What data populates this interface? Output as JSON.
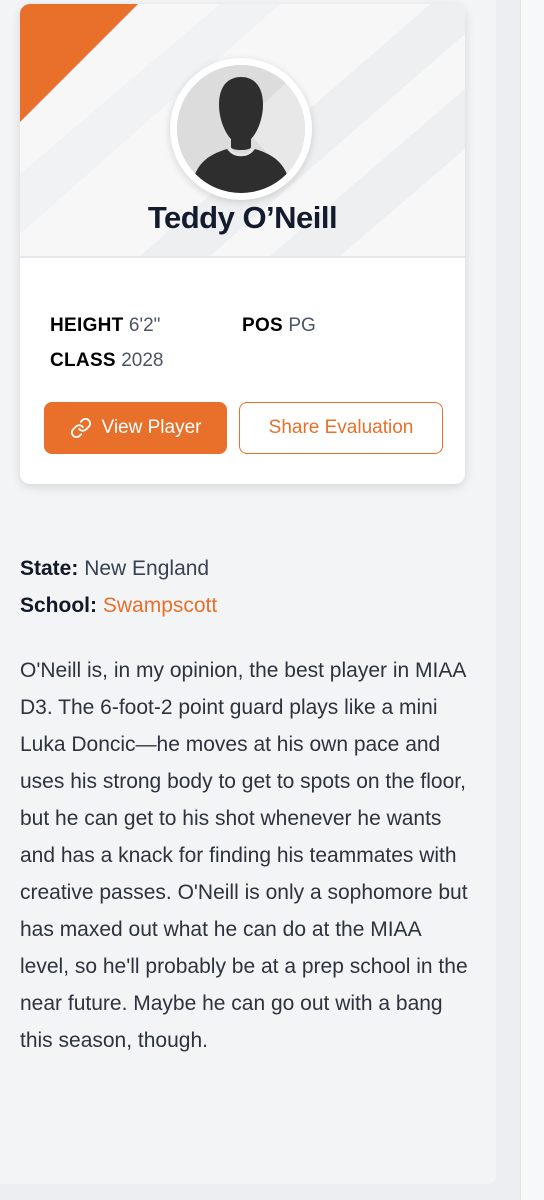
{
  "player": {
    "name": "Teddy O’Neill",
    "stats": {
      "height_label": "HEIGHT",
      "height_value": "6'2\"",
      "position_label": "POS",
      "position_value": "PG",
      "class_label": "CLASS",
      "class_value": "2028"
    },
    "buttons": {
      "view_label": "View Player",
      "share_label": "Share Evaluation"
    }
  },
  "details": {
    "state_label": "State:",
    "state_value": "New England",
    "school_label": "School:",
    "school_value": "Swampscott"
  },
  "evaluation": "O'Neill is, in my opinion, the best player in MIAA D3. The 6-foot-2 point guard plays like a mini Luka Doncic—he moves at his own pace and uses his strong body to get to spots on the floor, but he can get to his shot whenever he wants and has a knack for finding his teammates with creative passes. O'Neill is only a sophomore but has maxed out what he can do at the MIAA level, so he'll probably be at a prep school in the near future. Maybe he can go out with a bang this season, though.",
  "colors": {
    "accent": "#e8702a",
    "name_text": "#151b2e",
    "background": "#f3f4f6"
  },
  "icons": {
    "avatar": "person-silhouette-icon",
    "view_button": "link-icon"
  }
}
